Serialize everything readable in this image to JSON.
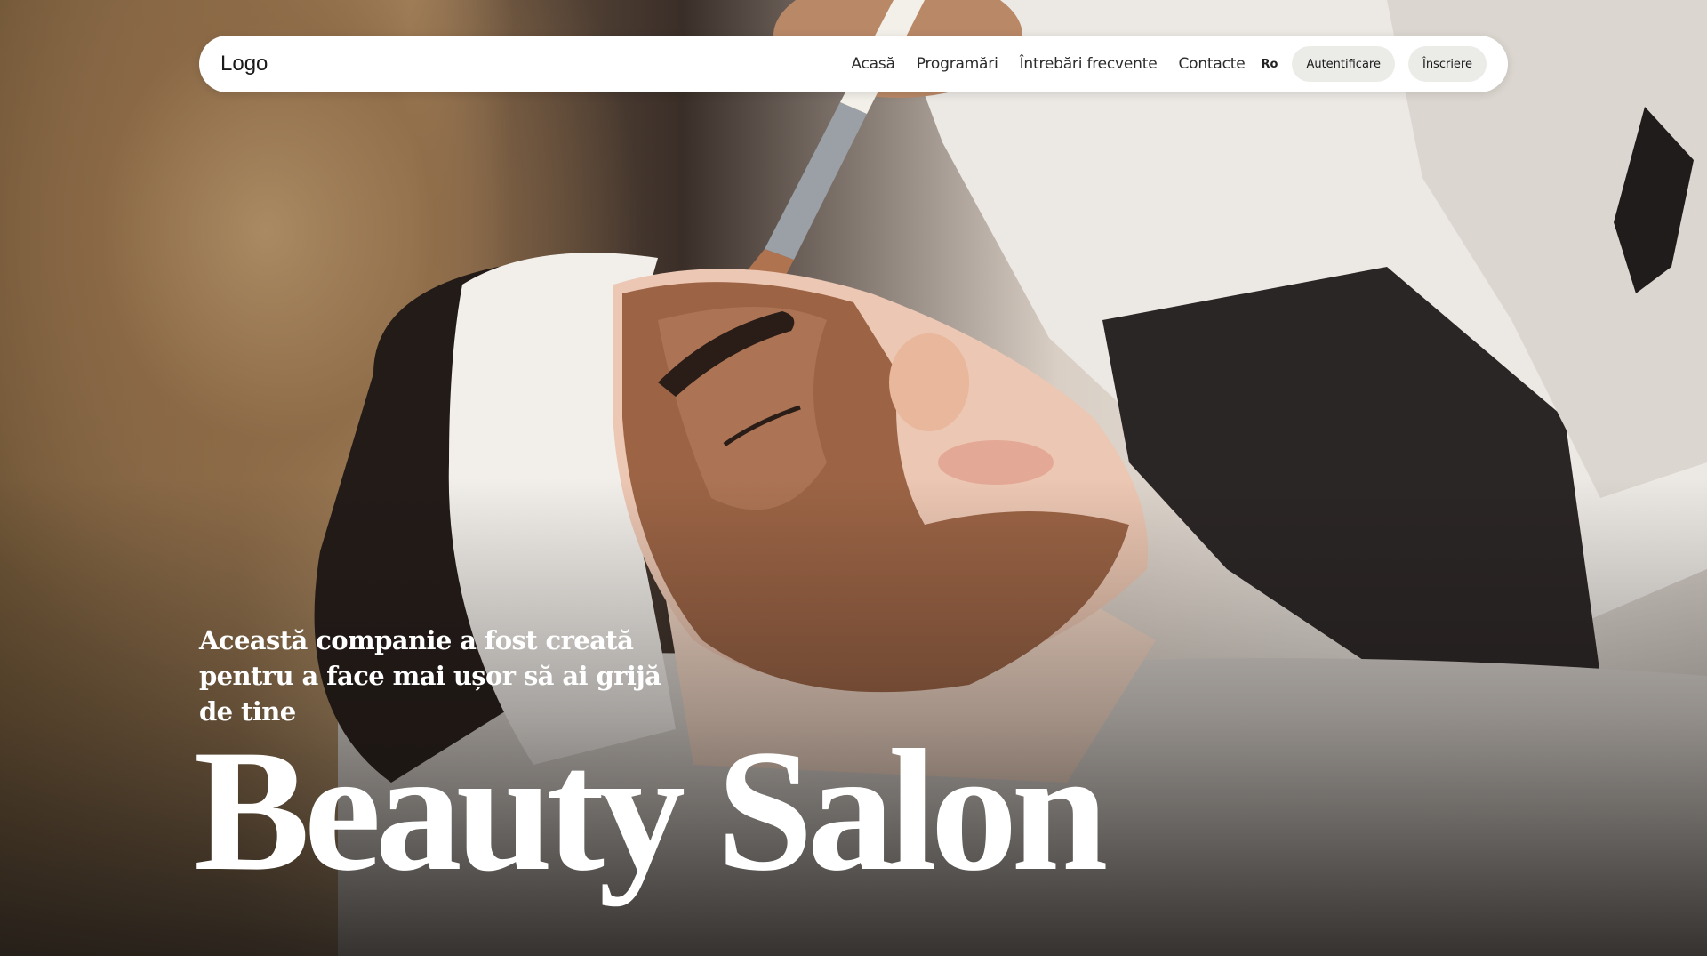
{
  "navbar": {
    "logo": "Logo",
    "links": [
      "Acasă",
      "Programări",
      "Întrebări frecvente",
      "Contacte"
    ],
    "language": "Ro",
    "login_label": "Autentificare",
    "signup_label": "Înscriere"
  },
  "hero": {
    "tagline": "Această companie a fost creată pentru a face mai ușor să ai grijă de tine",
    "title": "Beauty Salon"
  }
}
